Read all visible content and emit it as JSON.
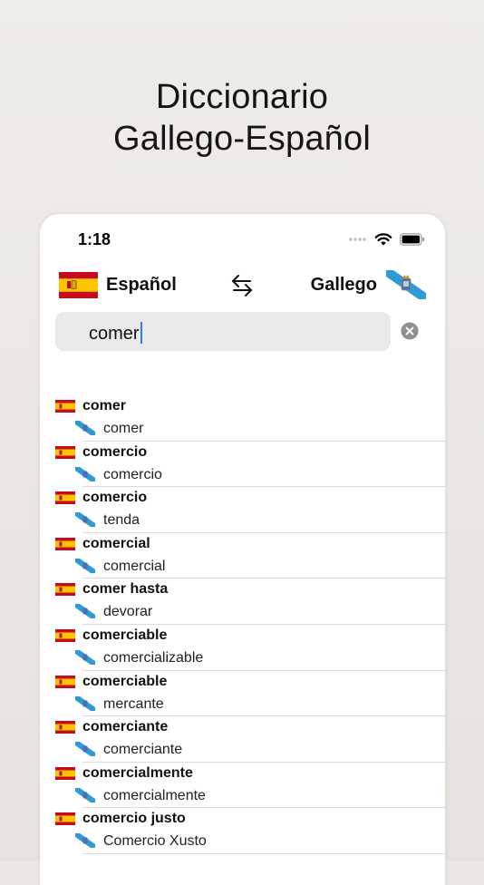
{
  "headline": {
    "line1": "Diccionario",
    "line2": "Gallego-Español"
  },
  "status_bar": {
    "time": "1:18"
  },
  "language_bar": {
    "source_language": "Español",
    "target_language": "Gallego",
    "source_flag": "spain-flag-icon",
    "target_flag": "galicia-flag-icon",
    "swap_icon": "swap-arrows-icon"
  },
  "search": {
    "value": "comer",
    "clear_icon": "clear-icon"
  },
  "results": [
    {
      "term": "comer",
      "translation": "comer"
    },
    {
      "term": "comercio",
      "translation": "comercio"
    },
    {
      "term": "comercio",
      "translation": "tenda"
    },
    {
      "term": "comercial",
      "translation": "comercial"
    },
    {
      "term": "comer hasta",
      "translation": "devorar"
    },
    {
      "term": "comerciable",
      "translation": "comercializable"
    },
    {
      "term": "comerciable",
      "translation": "mercante"
    },
    {
      "term": "comerciante",
      "translation": "comerciante"
    },
    {
      "term": "comercialmente",
      "translation": "comercialmente"
    },
    {
      "term": "comercio justo",
      "translation": "Comercio Xusto"
    }
  ],
  "colors": {
    "spain_red": "#c60b1e",
    "spain_yellow": "#ffc400",
    "galicia_blue": "#2e9ad6",
    "caret_blue": "#2f7cf6"
  }
}
